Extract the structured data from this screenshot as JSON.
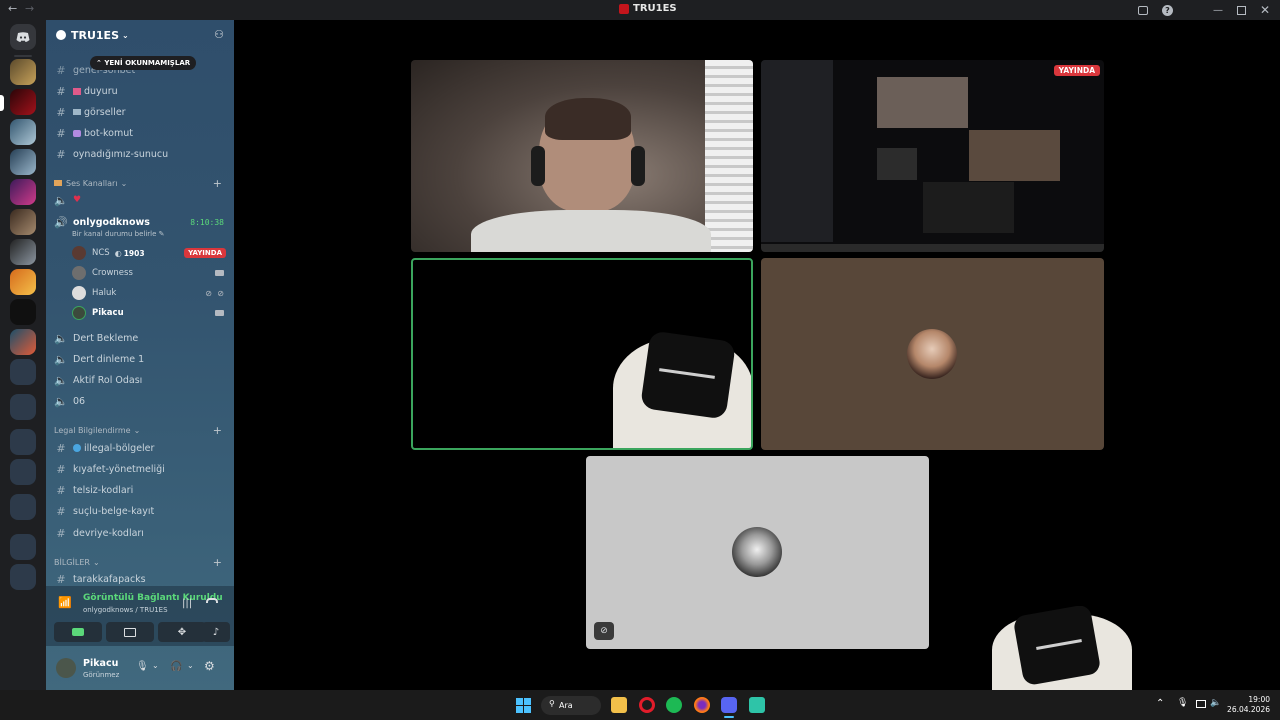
{
  "window": {
    "title": "TRU1ES"
  },
  "server": {
    "name": "TRU1ES"
  },
  "unread_pill": "YENİ OKUNMAMIŞLAR",
  "text_channels_top": [
    {
      "name": "genel-sohbet"
    },
    {
      "name": "duyuru"
    },
    {
      "name": "görseller"
    },
    {
      "name": "bot-komut"
    },
    {
      "name": "oynadığımız-sunucu"
    }
  ],
  "voice_category": {
    "label": "Ses Kanalları"
  },
  "active_voice": {
    "name": "onlygodknows",
    "timer": "8:10:38",
    "status_prompt": "Bir kanal durumu belirle",
    "users": [
      {
        "name": "NCS",
        "tag": "1903",
        "live": "YAYINDA"
      },
      {
        "name": "Crowness"
      },
      {
        "name": "Haluk"
      },
      {
        "name": "Pikacu"
      }
    ]
  },
  "voice_channels": [
    {
      "name": "Dert Bekleme"
    },
    {
      "name": "Dert dinleme 1"
    },
    {
      "name": "Aktif Rol Odası"
    },
    {
      "name": "06"
    }
  ],
  "legal_category": {
    "label": "Legal Bilgilendirme"
  },
  "legal_channels": [
    {
      "name": "illegal-bölgeler"
    },
    {
      "name": "kıyafet-yönetmeliği"
    },
    {
      "name": "telsiz-kodlari"
    },
    {
      "name": "suçlu-belge-kayıt"
    },
    {
      "name": "devriye-kodları"
    }
  ],
  "info_category": {
    "label": "BİLGİLER"
  },
  "info_channels": [
    {
      "name": "tarakkafapacks"
    }
  ],
  "voice_connection": {
    "status": "Görüntülü Bağlantı Kuruldu",
    "location": "onlygodknows / TRU1ES"
  },
  "user_panel": {
    "name": "Pikacu",
    "status": "Görünmez"
  },
  "stream_tag": "YAYINDA",
  "taskbar": {
    "search": "Ara",
    "time": "19:00",
    "date": "26.04.2026"
  },
  "colors": {
    "live": "#da373c",
    "connected": "#5bd87a",
    "speaking": "#3ba55d"
  }
}
